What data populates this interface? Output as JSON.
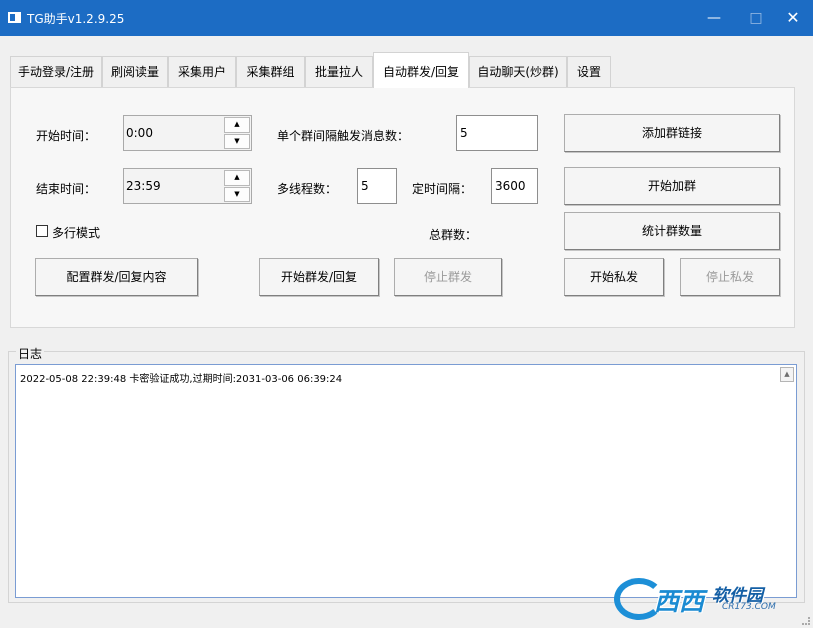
{
  "window": {
    "title": "TG助手v1.2.9.25",
    "minimize": "—",
    "maximize": "□",
    "close": "✕"
  },
  "tabs": [
    {
      "label": "手动登录/注册"
    },
    {
      "label": "刷阅读量"
    },
    {
      "label": "采集用户"
    },
    {
      "label": "采集群组"
    },
    {
      "label": "批量拉人"
    },
    {
      "label": "自动群发/回复"
    },
    {
      "label": "自动聊天(炒群)"
    },
    {
      "label": "设置"
    }
  ],
  "form": {
    "start_time_label": "开始时间：",
    "start_time_value": "0:00",
    "end_time_label": "结束时间：",
    "end_time_value": "23:59",
    "per_group_label": "单个群间隔触发消息数：",
    "per_group_value": "5",
    "threads_label": "多线程数：",
    "threads_value": "5",
    "interval_label": "定时间隔：",
    "interval_value": "3600",
    "multiline_label": "多行模式",
    "total_groups_label": "总群数："
  },
  "buttons": {
    "add_link": "添加群链接",
    "start_join": "开始加群",
    "count_groups": "统计群数量",
    "configure": "配置群发/回复内容",
    "start_broadcast": "开始群发/回复",
    "stop_broadcast": "停止群发",
    "start_dm": "开始私发",
    "stop_dm": "停止私发"
  },
  "log": {
    "title": "日志",
    "lines": [
      "2022-05-08 22:39:48 卡密验证成功,过期时间:2031-03-06 06:39:24"
    ]
  },
  "watermark": {
    "main": "西西",
    "sub": "软件园",
    "url": "CR173.COM"
  },
  "colors": {
    "titlebar": "#1c6cc4",
    "log_border": "#7a9cd3",
    "watermark": "#1b8bd2"
  }
}
